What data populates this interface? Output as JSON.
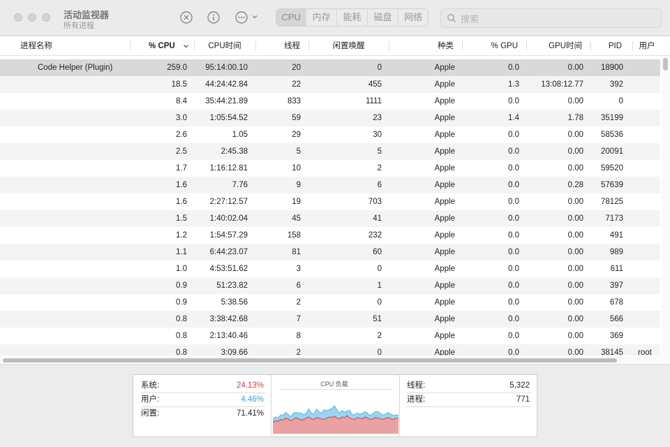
{
  "window": {
    "title": "活动监视器",
    "subtitle": "所有进程"
  },
  "toolbar": {
    "stop_icon": "xmark-circle-icon",
    "info_icon": "info-circle-icon",
    "more_icon": "ellipsis-circle-icon",
    "tabs": [
      {
        "label": "CPU",
        "active": true
      },
      {
        "label": "内存",
        "active": false
      },
      {
        "label": "能耗",
        "active": false
      },
      {
        "label": "磁盘",
        "active": false
      },
      {
        "label": "网络",
        "active": false
      }
    ],
    "search_placeholder": "搜索"
  },
  "table": {
    "columns": [
      "进程名称",
      "% CPU",
      "CPU时间",
      "线程",
      "闲置唤醒",
      "种类",
      "% GPU",
      "GPU时间",
      "PID",
      "用户"
    ],
    "sorted_column": "% CPU",
    "rows": [
      {
        "name": "Code Helper (Plugin)",
        "cpu": "259.0",
        "cpu_time": "95:14:00.10",
        "threads": "20",
        "idle_wakeups": "0",
        "kind": "Apple",
        "gpu": "0.0",
        "gpu_time": "0.00",
        "pid": "18900",
        "user": "",
        "selected": true
      },
      {
        "name": "",
        "cpu": "18.5",
        "cpu_time": "44:24:42.84",
        "threads": "22",
        "idle_wakeups": "455",
        "kind": "Apple",
        "gpu": "1.3",
        "gpu_time": "13:08:12.77",
        "pid": "392",
        "user": ""
      },
      {
        "name": "",
        "cpu": "8.4",
        "cpu_time": "35:44:21.89",
        "threads": "833",
        "idle_wakeups": "1111",
        "kind": "Apple",
        "gpu": "0.0",
        "gpu_time": "0.00",
        "pid": "0",
        "user": ""
      },
      {
        "name": "",
        "cpu": "3.0",
        "cpu_time": "1:05:54.52",
        "threads": "59",
        "idle_wakeups": "23",
        "kind": "Apple",
        "gpu": "1.4",
        "gpu_time": "1.78",
        "pid": "35199",
        "user": ""
      },
      {
        "name": "",
        "cpu": "2.6",
        "cpu_time": "1.05",
        "threads": "29",
        "idle_wakeups": "30",
        "kind": "Apple",
        "gpu": "0.0",
        "gpu_time": "0.00",
        "pid": "58536",
        "user": ""
      },
      {
        "name": "",
        "cpu": "2.5",
        "cpu_time": "2:45.38",
        "threads": "5",
        "idle_wakeups": "5",
        "kind": "Apple",
        "gpu": "0.0",
        "gpu_time": "0.00",
        "pid": "20091",
        "user": ""
      },
      {
        "name": "",
        "cpu": "1.7",
        "cpu_time": "1:16:12.81",
        "threads": "10",
        "idle_wakeups": "2",
        "kind": "Apple",
        "gpu": "0.0",
        "gpu_time": "0.00",
        "pid": "59520",
        "user": ""
      },
      {
        "name": "",
        "cpu": "1.6",
        "cpu_time": "7.76",
        "threads": "9",
        "idle_wakeups": "6",
        "kind": "Apple",
        "gpu": "0.0",
        "gpu_time": "0.28",
        "pid": "57639",
        "user": ""
      },
      {
        "name": "",
        "cpu": "1.6",
        "cpu_time": "2:27:12.57",
        "threads": "19",
        "idle_wakeups": "703",
        "kind": "Apple",
        "gpu": "0.0",
        "gpu_time": "0.00",
        "pid": "78125",
        "user": ""
      },
      {
        "name": "",
        "cpu": "1.5",
        "cpu_time": "1:40:02.04",
        "threads": "45",
        "idle_wakeups": "41",
        "kind": "Apple",
        "gpu": "0.0",
        "gpu_time": "0.00",
        "pid": "7173",
        "user": ""
      },
      {
        "name": "",
        "cpu": "1.2",
        "cpu_time": "1:54:57.29",
        "threads": "158",
        "idle_wakeups": "232",
        "kind": "Apple",
        "gpu": "0.0",
        "gpu_time": "0.00",
        "pid": "491",
        "user": ""
      },
      {
        "name": "",
        "cpu": "1.1",
        "cpu_time": "6:44:23.07",
        "threads": "81",
        "idle_wakeups": "60",
        "kind": "Apple",
        "gpu": "0.0",
        "gpu_time": "0.00",
        "pid": "989",
        "user": ""
      },
      {
        "name": "",
        "cpu": "1.0",
        "cpu_time": "4:53:51.62",
        "threads": "3",
        "idle_wakeups": "0",
        "kind": "Apple",
        "gpu": "0.0",
        "gpu_time": "0.00",
        "pid": "611",
        "user": ""
      },
      {
        "name": "",
        "cpu": "0.9",
        "cpu_time": "51:23.82",
        "threads": "6",
        "idle_wakeups": "1",
        "kind": "Apple",
        "gpu": "0.0",
        "gpu_time": "0.00",
        "pid": "397",
        "user": ""
      },
      {
        "name": "",
        "cpu": "0.9",
        "cpu_time": "5:38.56",
        "threads": "2",
        "idle_wakeups": "0",
        "kind": "Apple",
        "gpu": "0.0",
        "gpu_time": "0.00",
        "pid": "678",
        "user": ""
      },
      {
        "name": "",
        "cpu": "0.8",
        "cpu_time": "3:38:42.68",
        "threads": "7",
        "idle_wakeups": "51",
        "kind": "Apple",
        "gpu": "0.0",
        "gpu_time": "0.00",
        "pid": "566",
        "user": ""
      },
      {
        "name": "",
        "cpu": "0.8",
        "cpu_time": "2:13:40.46",
        "threads": "8",
        "idle_wakeups": "2",
        "kind": "Apple",
        "gpu": "0.0",
        "gpu_time": "0.00",
        "pid": "369",
        "user": ""
      },
      {
        "name": "",
        "cpu": "0.8",
        "cpu_time": "3:09.66",
        "threads": "2",
        "idle_wakeups": "0",
        "kind": "Apple",
        "gpu": "0.0",
        "gpu_time": "0.00",
        "pid": "38145",
        "user": "root"
      }
    ]
  },
  "summary": {
    "system_label": "系统:",
    "system_value": "24.13%",
    "system_color": "#e0393e",
    "user_label": "用户:",
    "user_value": "4.46%",
    "user_color": "#2fa5e0",
    "idle_label": "闲置:",
    "idle_value": "71.41%",
    "cpu_load_title": "CPU 负载",
    "threads_label": "线程:",
    "threads_value": "5,322",
    "processes_label": "进程:",
    "processes_value": "771"
  },
  "chart_data": {
    "type": "area",
    "title": "CPU 负载",
    "series": [
      {
        "values": [
          18,
          20,
          19,
          22,
          21,
          24,
          23,
          20,
          22,
          25,
          23,
          21,
          22,
          24,
          26,
          23,
          22,
          25,
          24,
          23,
          22,
          24,
          26,
          25,
          27,
          24,
          23,
          26,
          25,
          28,
          24,
          23,
          22,
          25,
          24,
          23,
          26,
          24,
          22,
          23,
          25,
          24,
          23,
          22,
          24,
          25,
          23,
          22,
          24,
          23
        ],
        "color": "#e0393e"
      },
      {
        "values": [
          4,
          6,
          5,
          7,
          8,
          9,
          7,
          6,
          10,
          8,
          9,
          11,
          7,
          8,
          12,
          9,
          8,
          13,
          10,
          9,
          15,
          12,
          11,
          14,
          16,
          13,
          9,
          10,
          8,
          7,
          12,
          6,
          8,
          7,
          6,
          9,
          8,
          7,
          6,
          8,
          9,
          10,
          8,
          7,
          6,
          8,
          7,
          6,
          5,
          6
        ],
        "color": "#4fb7e6"
      }
    ],
    "ylim": [
      0,
      100
    ]
  }
}
